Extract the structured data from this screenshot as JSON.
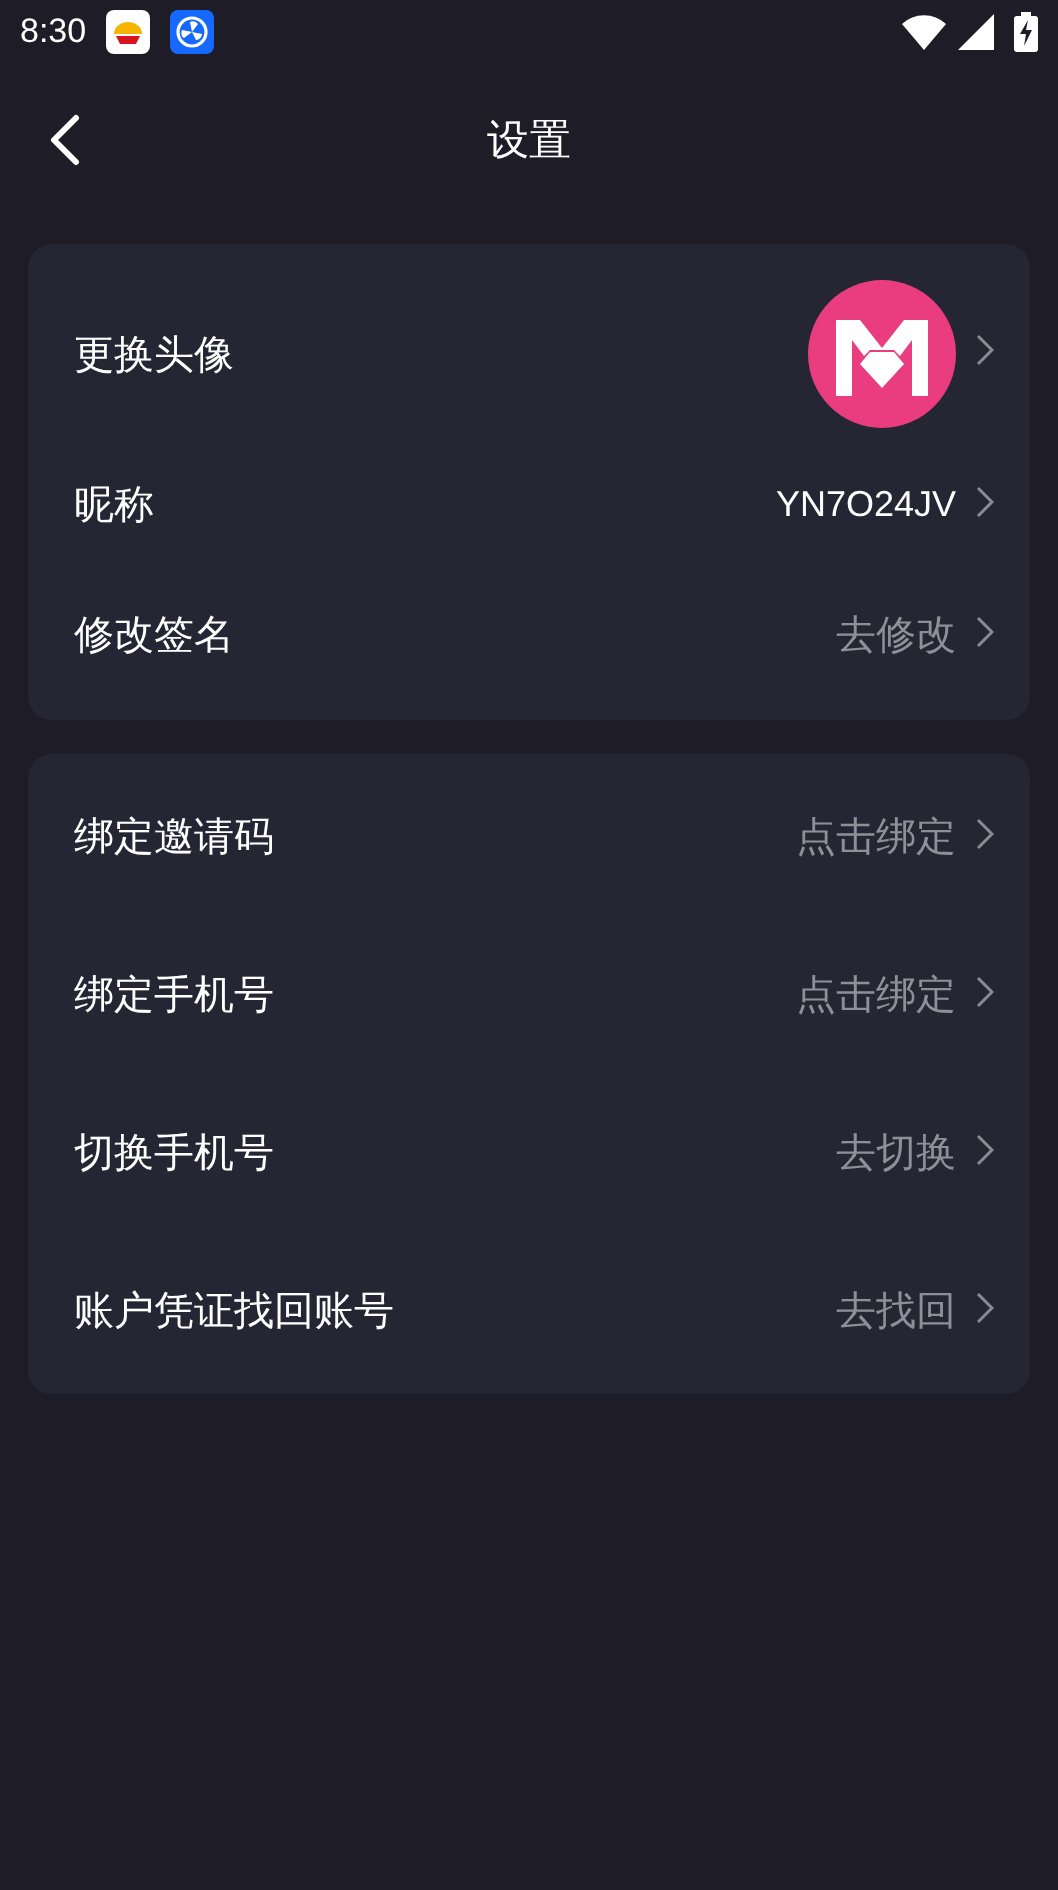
{
  "status_bar": {
    "time": "8:30"
  },
  "header": {
    "title": "设置"
  },
  "groups": [
    {
      "rows": [
        {
          "kind": "avatar",
          "label": "更换头像"
        },
        {
          "kind": "value",
          "label": "昵称",
          "value": "YN7O24JV"
        },
        {
          "kind": "action",
          "label": "修改签名",
          "value": "去修改"
        }
      ]
    },
    {
      "rows": [
        {
          "kind": "action",
          "label": "绑定邀请码",
          "value": "点击绑定"
        },
        {
          "kind": "action",
          "label": "绑定手机号",
          "value": "点击绑定"
        },
        {
          "kind": "action",
          "label": "切换手机号",
          "value": "去切换"
        },
        {
          "kind": "action",
          "label": "账户凭证找回账号",
          "value": "去找回"
        }
      ]
    }
  ]
}
